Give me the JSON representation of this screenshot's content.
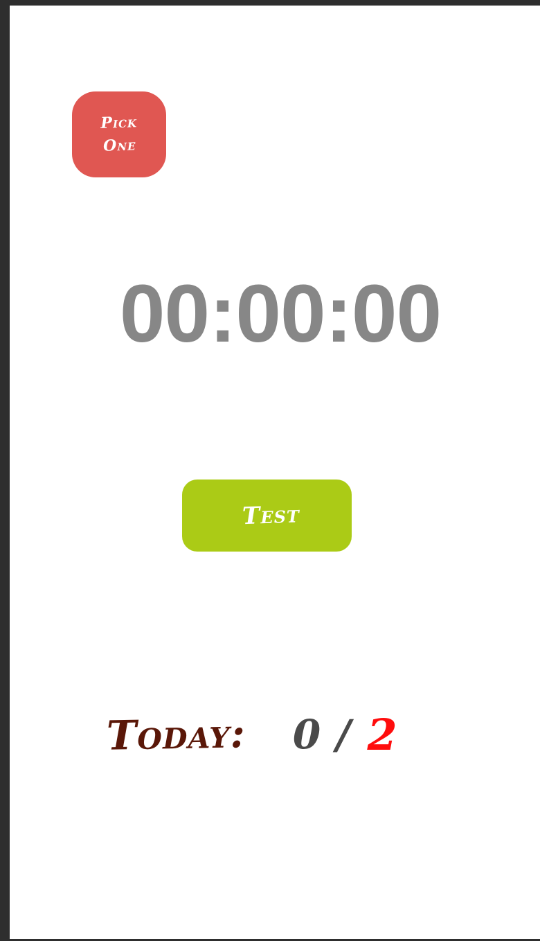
{
  "pick_button": {
    "label": "Pick\nOne"
  },
  "timer": {
    "value": "00:00:00"
  },
  "test_button": {
    "label": "Test"
  },
  "today": {
    "label": "Today:",
    "done": "0",
    "separator": "/",
    "goal": "2"
  },
  "colors": {
    "pick_button": "#e05752",
    "test_button": "#abcb16",
    "timer_text": "#878787",
    "today_label": "#5a1708",
    "goal": "#ff0d0d"
  }
}
